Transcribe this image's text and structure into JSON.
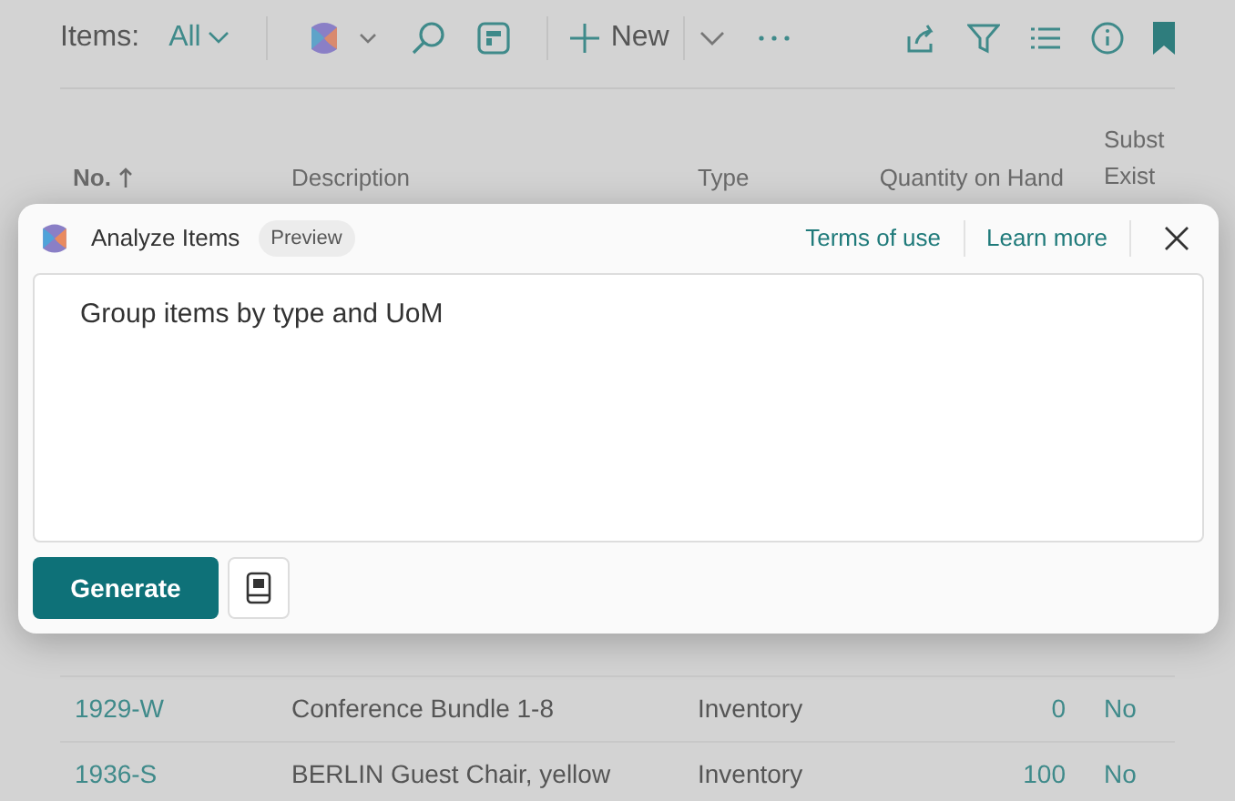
{
  "toolbar": {
    "title": "Items:",
    "view": "All",
    "new_label": "New"
  },
  "table": {
    "columns": [
      {
        "label": "No.",
        "sorted": true
      },
      {
        "label": "Description",
        "sorted": false
      },
      {
        "label": "Type",
        "sorted": false
      },
      {
        "label": "Quantity on Hand",
        "sorted": false
      },
      {
        "label": "Subst Exist",
        "sorted": false
      }
    ],
    "rows": [
      {
        "no": "1929-W",
        "description": "Conference Bundle 1-8",
        "type": "Inventory",
        "quantity": "0",
        "substitutes": "No"
      },
      {
        "no": "1936-S",
        "description": "BERLIN Guest Chair, yellow",
        "type": "Inventory",
        "quantity": "100",
        "substitutes": "No"
      }
    ]
  },
  "dialog": {
    "title": "Analyze Items",
    "badge": "Preview",
    "links": [
      "Terms of use",
      "Learn more"
    ],
    "prompt": "Group items by type and UoM",
    "button": "Generate"
  }
}
